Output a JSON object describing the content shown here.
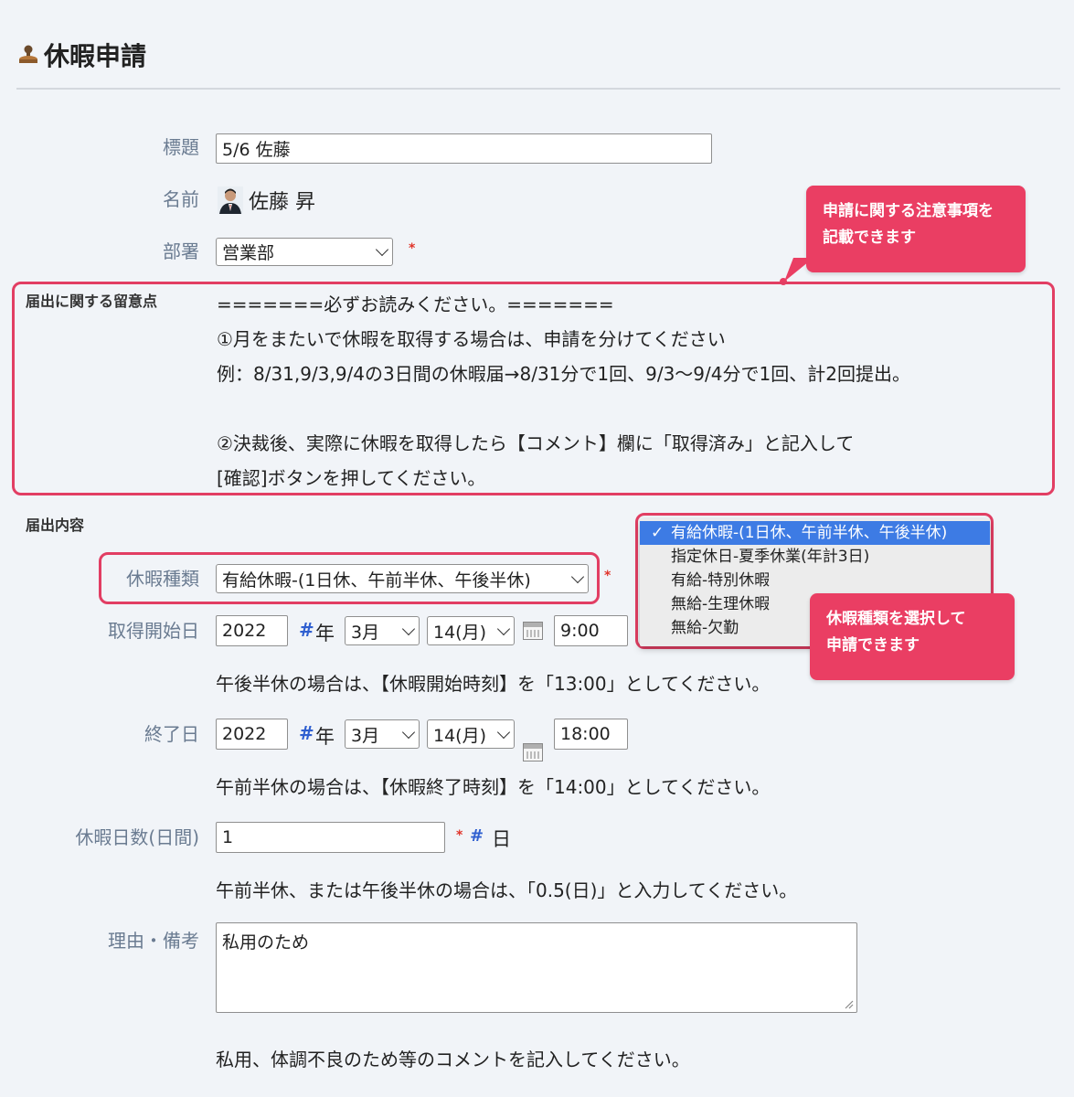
{
  "page": {
    "title": "休暇申請",
    "icon": "stamp-icon"
  },
  "form": {
    "subject": {
      "label": "標題",
      "value": "5/6 佐藤"
    },
    "name": {
      "label": "名前",
      "value": "佐藤 昇"
    },
    "department": {
      "label": "部署",
      "value": "営業部",
      "required_mark": "*"
    },
    "notice": {
      "label": "届出に関する留意点",
      "lines": [
        "=======必ずお読みください。=======",
        "①月をまたいで休暇を取得する場合は、申請を分けてください",
        "例：8/31,9/3,9/4の3日間の休暇届→8/31分で1回、9/3～9/4分で1回、計2回提出。",
        "",
        "②決裁後、実際に休暇を取得したら【コメント】欄に「取得済み」と記入して",
        "[確認]ボタンを押してください。"
      ]
    },
    "content_section_label": "届出内容",
    "leave_type": {
      "label": "休暇種類",
      "value": "有給休暇-(1日休、午前半休、午後半休)",
      "required_mark": "*",
      "options": [
        "有給休暇-(1日休、午前半休、午後半休)",
        "指定休日-夏季休業(年計3日)",
        "有給-特別休暇",
        "無給-生理休暇",
        "無給-欠勤"
      ],
      "selected_check": "✓"
    },
    "start_date": {
      "label": "取得開始日",
      "year": "2022",
      "hash": "#",
      "year_unit": "年",
      "month": "3月",
      "day": "14(月)",
      "time": "9:00",
      "note": "午後半休の場合は、【休暇開始時刻】を「13:00」としてください。"
    },
    "end_date": {
      "label": "終了日",
      "year": "2022",
      "hash": "#",
      "year_unit": "年",
      "month": "3月",
      "day": "14(月)",
      "time": "18:00",
      "note": "午前半休の場合は、【休暇終了時刻】を「14:00」としてください。"
    },
    "days": {
      "label": "休暇日数(日間)",
      "value": "1",
      "required_mark": "*",
      "hash": "#",
      "unit": "日",
      "note": "午前半休、または午後半休の場合は、「0.5(日)」と入力してください。"
    },
    "reason": {
      "label": "理由・備考",
      "value": "私用のため",
      "note": "私用、体調不良のため等のコメントを記入してください。"
    }
  },
  "callouts": {
    "notice": [
      "申請に関する注意事項を",
      "記載できます"
    ],
    "leave_type": [
      "休暇種類を選択して",
      "申請できます"
    ]
  },
  "colors": {
    "highlight": "#e23e63",
    "callout_bg": "#ea3e63",
    "selected_option": "#3d7be4",
    "label": "#6a7b91",
    "required": "#e0342a",
    "hash": "#2f5fd0"
  }
}
